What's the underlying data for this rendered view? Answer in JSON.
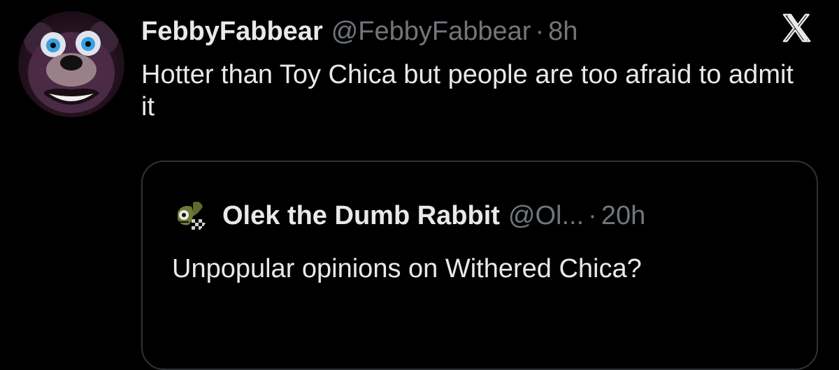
{
  "tweet": {
    "avatar_icon": "bear-mascot-avatar",
    "display_name": "FebbyFabbear",
    "handle": "@FebbyFabbear",
    "separator": "·",
    "time": "8h",
    "text": "Hotter than Toy Chica but people are too afraid to admit it",
    "platform_icon": "x-logo-icon"
  },
  "quote": {
    "avatar_icon": "animatronic-rabbit-avatar",
    "display_name": "Olek the Dumb Rabbit",
    "handle": "@Ol...",
    "separator": "·",
    "time": "20h",
    "text": "Unpopular opinions on Withered Chica?"
  },
  "colors": {
    "background": "#000000",
    "primary_text": "#e7e9ea",
    "secondary_text": "#71767b",
    "border": "#2f3336"
  }
}
